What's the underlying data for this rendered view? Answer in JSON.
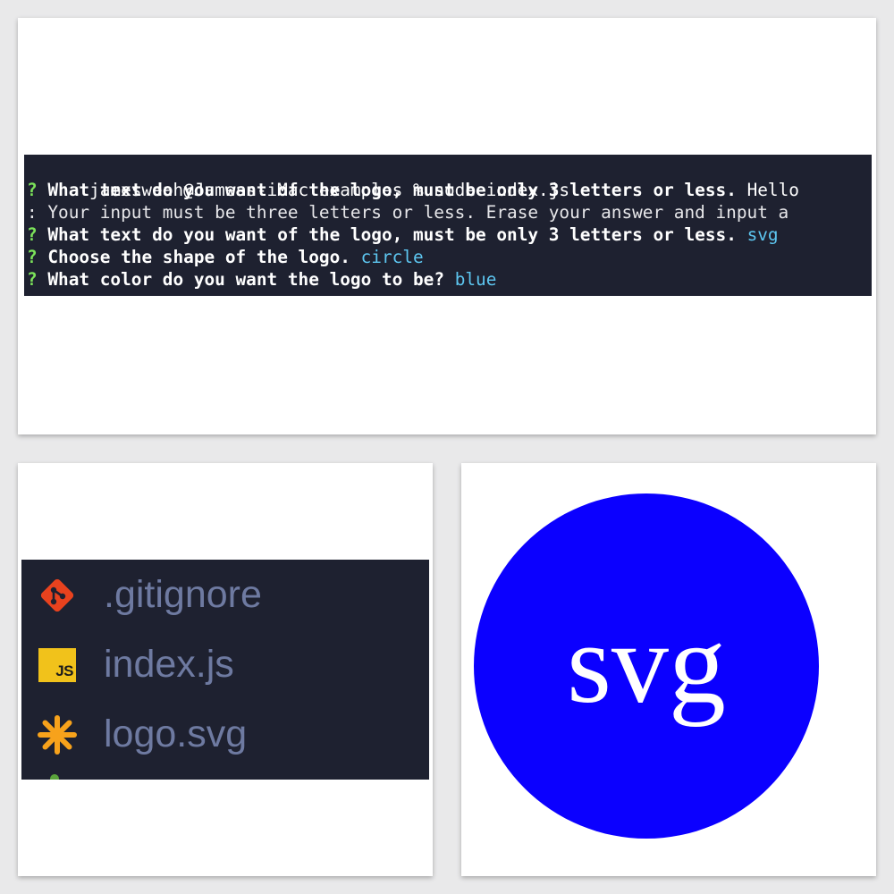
{
  "terminal": {
    "prompt_line": "jamesweah@Jamess-iMac examples % node index.js",
    "q_mark": "?",
    "question_text": "What text do you want of the logo, must be only 3 letters or less.",
    "answer_rejected": "Hello",
    "error_prefix": ":",
    "error_message": " Your input must be three letters or less. Erase your answer and input a",
    "answer_text": "svg",
    "shape_question": "Choose the shape of the logo.",
    "answer_shape": "circle",
    "color_question": "What color do you want the logo to be?",
    "answer_color": "blue"
  },
  "explorer": {
    "files": [
      {
        "name": ".gitignore",
        "icon": "git-icon"
      },
      {
        "name": "index.js",
        "icon": "js-icon"
      },
      {
        "name": "logo.svg",
        "icon": "svg-asterisk-icon"
      }
    ],
    "js_badge_label": "JS"
  },
  "logo": {
    "text": "svg",
    "fill_color": "#0b00ff",
    "text_color": "#ffffff"
  },
  "colors": {
    "terminal_bg": "#1e2130",
    "prompt_green": "#7ce35a",
    "answer_cyan": "#5dc6f0",
    "git_orange": "#e8421e",
    "svg_orange": "#f7a21b",
    "file_label": "#6e7aa1"
  }
}
